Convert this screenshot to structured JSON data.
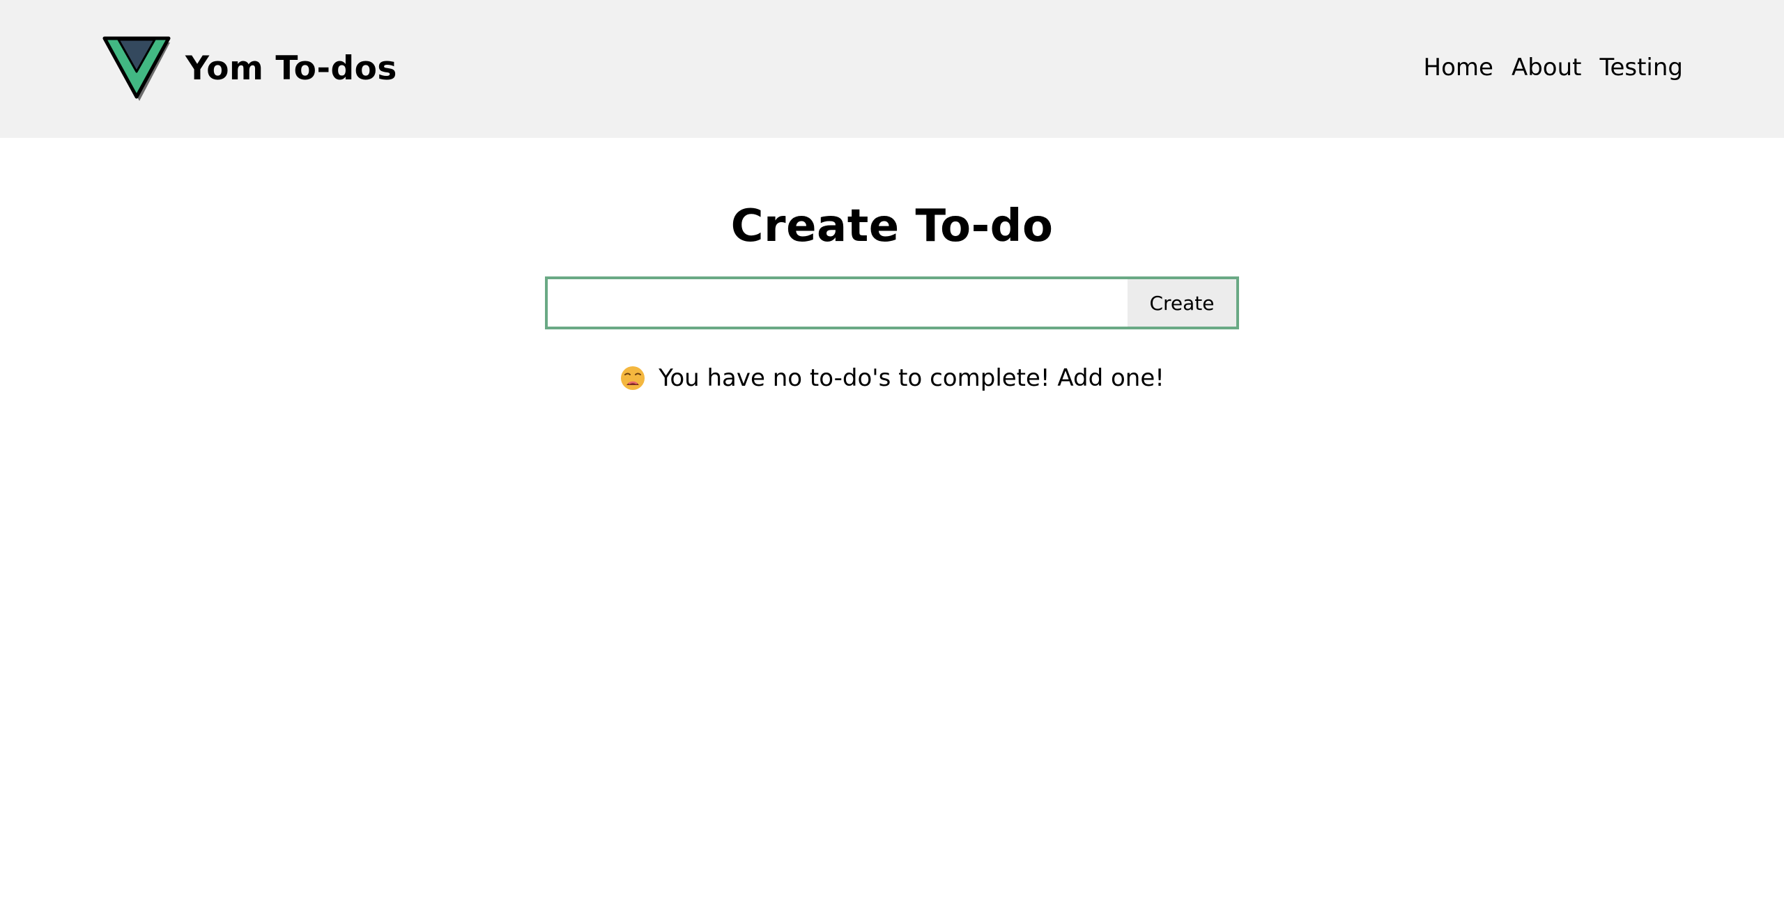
{
  "header": {
    "app_title": "Yom To-dos",
    "logo_icon": "vue-v-logo-icon",
    "nav": [
      {
        "label": "Home"
      },
      {
        "label": "About"
      },
      {
        "label": "Testing"
      }
    ]
  },
  "main": {
    "title": "Create To-do",
    "input": {
      "value": "",
      "placeholder": ""
    },
    "create_label": "Create",
    "empty_message": "You have no to-do's to complete! Add one!",
    "empty_icon": "weary-face-emoji-icon"
  },
  "colors": {
    "header_bg": "#f1f1f1",
    "accent": "#6aa985",
    "logo_dark": "#34495e",
    "logo_green": "#42b883"
  }
}
